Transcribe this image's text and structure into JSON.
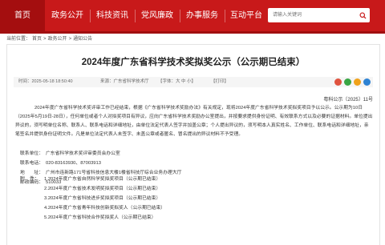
{
  "nav": {
    "items": [
      {
        "label": "首页",
        "active": true
      },
      {
        "label": "政务公开",
        "active": false
      },
      {
        "label": "科技资讯",
        "active": false
      },
      {
        "label": "党风廉政",
        "active": false
      },
      {
        "label": "办事服务",
        "active": false
      },
      {
        "label": "互动平台",
        "active": false
      }
    ],
    "search_placeholder": "请输入关键词"
  },
  "breadcrumb": {
    "prefix": "当前位置：",
    "items": [
      "首页",
      "政务公开",
      "通知公告"
    ],
    "separator": ">"
  },
  "article": {
    "title": "2024年度广东省科学技术奖拟奖公示（公示期已结束）",
    "meta": {
      "time": "时间：2025-05-18 18:50:40",
      "source": "来源：广东省科学技术厅",
      "font": "【字体：大  中  小】",
      "print": "【打印】"
    },
    "doc_number": "粤科公示〔2025〕11号",
    "paragraph": "2024年度广东省科学技术奖评审工作已经结束，根据《广东省科学技术奖励办法》有关规定，现将2024年度广东省科学技术奖拟奖项目予以公示。公示期为10日（2025年5月19日-28日），任何单位或者个人对拟奖项目有异议，应向广东省科学技术奖励办公室提出，并按要求提供身份证明、有效联系方式以及必要的证据材料。单位提出异议的，须写明单位名称、联系人、联系电话和详细地址，由单位法定代表人签字并加盖公章；个人提出异议的，须写明本人真实姓名、工作单位、联系电话和详细地址，亲笔签名并提供身份证明文件。凡是单位法定代表人未签字、未盖公章或者匿名、冒名提出的异议材料不予受理。",
    "contacts": [
      {
        "label": "联系单位：",
        "value": "广东省科学技术奖评审委员会办公室"
      },
      {
        "label": "联系电话：",
        "value": "020-83163930、87003913"
      },
      {
        "label": "地　　址：",
        "value": "广州市连新路171号省科技信息大楼1楼省科技厅综合业务办理大厅"
      },
      {
        "label": "邮政编码：",
        "value": "510033"
      }
    ],
    "attachments_label": "附　件：",
    "attachments": [
      "1.2024年度广东省自然科学奖拟奖项目（公示期已结束）",
      "2.2024年度广东省技术发明奖拟奖项目（公示期已结束）",
      "3.2024年度广东省科技进步奖拟奖项目（公示期已结束）",
      "4.2024年度广东省青年科技创新奖拟奖人（公示期已结束）",
      "5.2024年度广东省科技合作奖拟奖人（公示期已结束）"
    ]
  }
}
